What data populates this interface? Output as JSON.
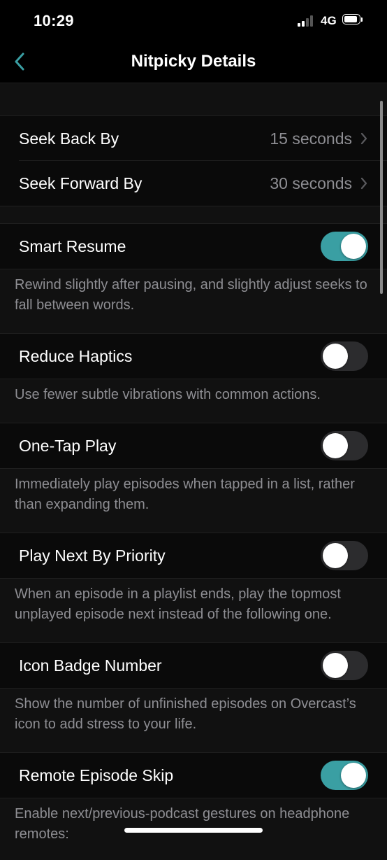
{
  "status_bar": {
    "time": "10:29",
    "network": "4G",
    "signal_icon": "cellular-signal-icon",
    "battery_icon": "battery-icon"
  },
  "nav": {
    "title": "Nitpicky Details",
    "back_icon": "chevron-left-icon",
    "accent_color": "#3a9fa3"
  },
  "seek": {
    "back_label": "Seek Back By",
    "back_value": "15 seconds",
    "forward_label": "Seek Forward By",
    "forward_value": "30 seconds"
  },
  "settings": [
    {
      "label": "Smart Resume",
      "on": true,
      "description": "Rewind slightly after pausing, and slightly adjust seeks to fall between words."
    },
    {
      "label": "Reduce Haptics",
      "on": false,
      "description": "Use fewer subtle vibrations with common actions."
    },
    {
      "label": "One-Tap Play",
      "on": false,
      "description": "Immediately play episodes when tapped in a list, rather than expanding them."
    },
    {
      "label": "Play Next By Priority",
      "on": false,
      "description": "When an episode in a playlist ends, play the topmost unplayed episode next instead of the following one."
    },
    {
      "label": "Icon Badge Number",
      "on": false,
      "description": "Show the number of unfinished episodes on Overcast’s icon to add stress to your life."
    },
    {
      "label": "Remote Episode Skip",
      "on": true,
      "description": "Enable next/previous-podcast gestures on headphone remotes:"
    }
  ]
}
